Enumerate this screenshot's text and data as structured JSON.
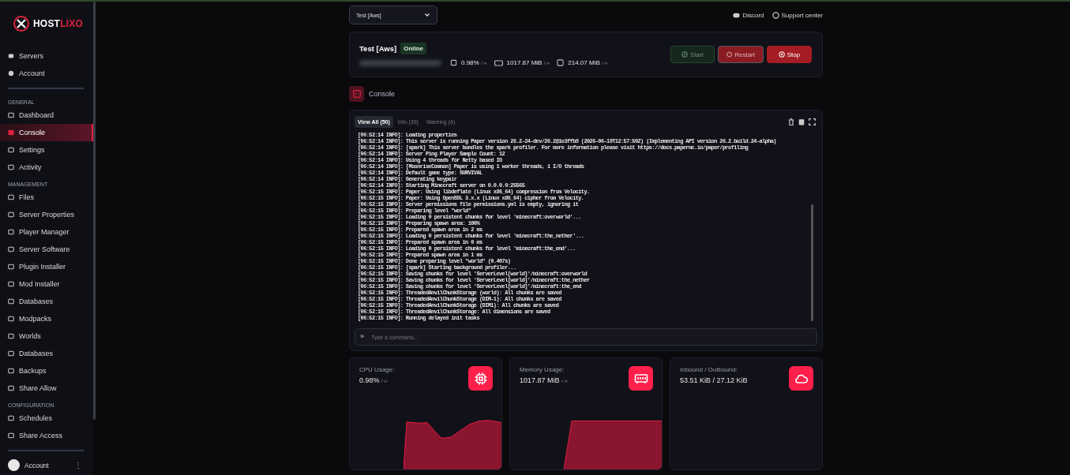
{
  "sidebar": {
    "logo": {
      "part1": "HOST",
      "part2": "LIXO"
    },
    "top_items": [
      {
        "label": "Servers",
        "selected": false
      },
      {
        "label": "Account",
        "selected": false
      }
    ],
    "sections": [
      {
        "title": "GENERAL",
        "items": [
          {
            "label": "Dashboard",
            "selected": false
          },
          {
            "label": "Console",
            "selected": true
          },
          {
            "label": "Settings",
            "selected": false
          },
          {
            "label": "Activity",
            "selected": false
          }
        ]
      },
      {
        "title": "MANAGEMENT",
        "items": [
          {
            "label": "Files",
            "selected": false
          },
          {
            "label": "Server Properties",
            "selected": false
          },
          {
            "label": "Player Manager",
            "selected": false
          },
          {
            "label": "Server Software",
            "selected": false
          },
          {
            "label": "Plugin Installer",
            "selected": false
          },
          {
            "label": "Mod Installer",
            "selected": false
          },
          {
            "label": "Databases",
            "selected": false
          },
          {
            "label": "Modpacks",
            "selected": false
          },
          {
            "label": "Worlds",
            "selected": false
          },
          {
            "label": "Databases",
            "selected": false
          },
          {
            "label": "Backups",
            "selected": false
          },
          {
            "label": "Share Allow",
            "selected": false
          }
        ]
      },
      {
        "title": "CONFIGURATION",
        "items": [
          {
            "label": "Schedules",
            "selected": false
          },
          {
            "label": "Share Access",
            "selected": false
          }
        ]
      }
    ],
    "account": {
      "label": "Account",
      "menu": "⋮"
    }
  },
  "header": {
    "server_select": "Test [Aws]",
    "links": [
      {
        "label": "Discord"
      },
      {
        "label": "Support center"
      }
    ]
  },
  "server": {
    "name": "Test [Aws]",
    "status": "Online",
    "cpu": "0.98%",
    "cpu_limit": "/ ∞",
    "memory": "1017.87 MiB",
    "memory_limit": "/ ∞",
    "disk": "214.07 MiB",
    "disk_limit": "/ ∞",
    "buttons": [
      {
        "label": "Start",
        "kind": "start",
        "disabled": true
      },
      {
        "label": "Restart",
        "kind": "restart",
        "disabled": false
      },
      {
        "label": "Stop",
        "kind": "stop",
        "disabled": false
      }
    ]
  },
  "section_title": "Console",
  "console": {
    "tabs": [
      {
        "label": "View All (50)",
        "selected": true
      },
      {
        "label": "Info (39)",
        "selected": false
      },
      {
        "label": "Warning (4)",
        "selected": false
      }
    ],
    "lines": [
      "[06:52:14 INFO]: Loading properties",
      "[06:52:14 INFO]: This server is running Paper version 26.2-24-dev/26.2@1e3ffb9 (2026-06-19T12:57:50Z) (Implementing API version 26.2.build.24-alpha)",
      "[06:52:14 INFO]: [spark] This server bundles the spark profiler. For more information please visit https://docs.papermc.io/paper/profiling",
      "[06:52:14 INFO]: Server Ping Player Sample Count: 12",
      "[06:52:14 INFO]: Using 4 threads for Netty based IO",
      "[06:52:14 INFO]: [MoonriseCommon] Paper is using 1 worker threads, 1 I/O threads",
      "[06:52:14 INFO]: Default game type: SURVIVAL",
      "[06:52:14 INFO]: Generating keypair",
      "[06:52:14 INFO]: Starting Minecraft server on 0.0.0.0:25565",
      "[06:52:15 INFO]: Paper: Using libdeflate (Linux x86_64) compression from Velocity.",
      "[06:52:15 INFO]: Paper: Using OpenSSL 3.x.x (Linux x86_64) cipher from Velocity.",
      "[06:52:15 INFO]: Server permissions file permissions.yml is empty, ignoring it",
      "[06:52:15 INFO]: Preparing level \"world\"",
      "[06:52:15 INFO]: Loading 0 persistent chunks for level 'minecraft:overworld'...",
      "[06:52:15 INFO]: Preparing spawn area: 100%",
      "[06:52:15 INFO]: Prepared spawn area in 2 ms",
      "[06:52:15 INFO]: Loading 0 persistent chunks for level 'minecraft:the_nether'...",
      "[06:52:15 INFO]: Prepared spawn area in 0 ms",
      "[06:52:15 INFO]: Loading 0 persistent chunks for level 'minecraft:the_end'...",
      "[06:52:15 INFO]: Prepared spawn area in 1 ms",
      "[06:52:15 INFO]: Done preparing level \"world\" (0.407s)",
      "[06:52:15 INFO]: [spark] Starting background profiler...",
      "[06:52:15 INFO]: Saving chunks for level 'ServerLevel[world]'/minecraft:overworld",
      "[06:52:15 INFO]: Saving chunks for level 'ServerLevel[world]'/minecraft:the_nether",
      "[06:52:15 INFO]: Saving chunks for level 'ServerLevel[world]'/minecraft:the_end",
      "[06:52:15 INFO]: ThreadedAnvilChunkStorage (world): All chunks are saved",
      "[06:52:15 INFO]: ThreadedAnvilChunkStorage (DIM-1): All chunks are saved",
      "[06:52:15 INFO]: ThreadedAnvilChunkStorage (DIM1): All chunks are saved",
      "[06:52:15 INFO]: ThreadedAnvilChunkStorage: All dimensions are saved",
      "[06:52:15 INFO]: Running delayed init tasks"
    ],
    "command_prompt": "»",
    "command_placeholder": "Type a command..."
  },
  "stats": [
    {
      "kind": "cpu",
      "label": "CPU Usage:",
      "value": "0.98%",
      "limit": "/ ∞"
    },
    {
      "kind": "memory",
      "label": "Memory Usage:",
      "value": "1017.87 MiB",
      "limit": "/ ∞"
    },
    {
      "kind": "network",
      "label": "Inbound / Outbound:",
      "value": "53.51 KiB / 27.12 KiB"
    }
  ]
}
